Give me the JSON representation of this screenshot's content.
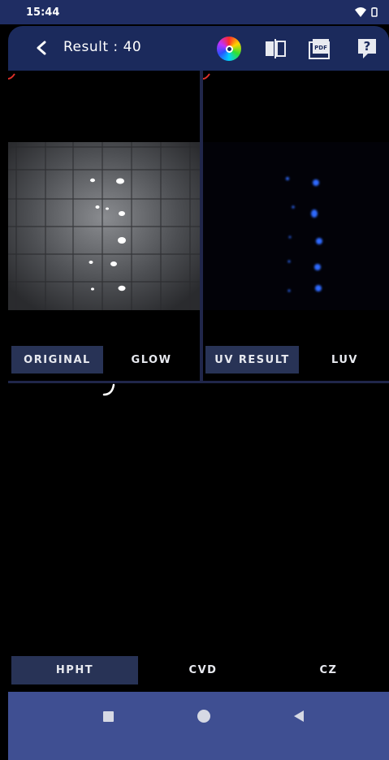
{
  "status": {
    "time": "15:44"
  },
  "appbar": {
    "title": "Result : 40"
  },
  "panels": {
    "left_tabs": [
      {
        "label": "ORIGINAL",
        "active": true
      },
      {
        "label": "GLOW",
        "active": false
      }
    ],
    "right_tabs": [
      {
        "label": "UV RESULT",
        "active": true
      },
      {
        "label": "LUV",
        "active": false
      }
    ]
  },
  "bottom_tabs": [
    {
      "label": "HPHT",
      "active": true
    },
    {
      "label": "CVD",
      "active": false
    },
    {
      "label": "CZ",
      "active": false
    }
  ],
  "colors": {
    "statusbar": "#1f2d63",
    "appbar": "#1b2a5c",
    "active_tab": "#283356",
    "navbar": "#3f4f92",
    "uv_glow": "#2f6bff"
  },
  "icons": [
    "back-icon",
    "color-wheel-icon",
    "compare-icon",
    "pdf-icon",
    "help-icon",
    "wifi-icon",
    "battery-icon",
    "recents-icon",
    "home-icon",
    "back-nav-icon"
  ]
}
